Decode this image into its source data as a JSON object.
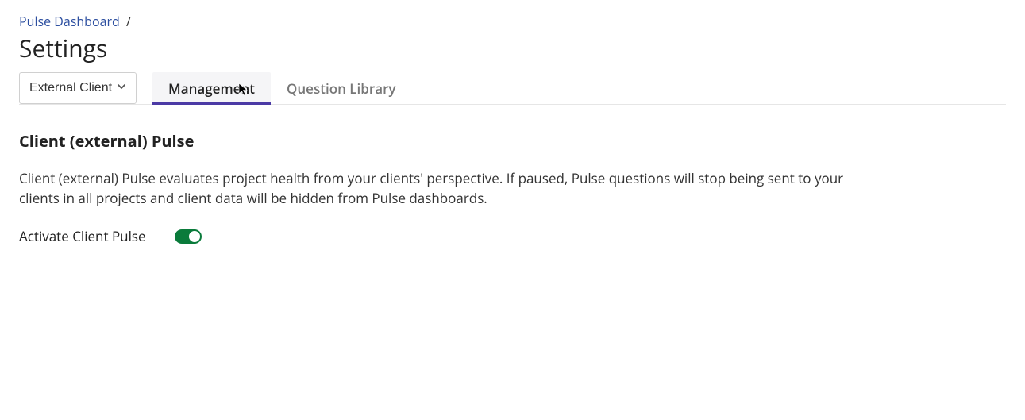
{
  "breadcrumb": {
    "parent": "Pulse Dashboard",
    "separator": "/"
  },
  "page_title": "Settings",
  "dropdown": {
    "selected": "External Client"
  },
  "tabs": {
    "management": {
      "label": "Management",
      "active": true
    },
    "question_library": {
      "label": "Question Library",
      "active": false
    }
  },
  "section": {
    "title": "Client (external) Pulse",
    "description": "Client (external) Pulse evaluates project health from your clients' perspective. If paused, Pulse questions will stop being sent to your clients in all projects and client data will be hidden from Pulse dashboards.",
    "toggle_label": "Activate Client Pulse",
    "toggle_on": true
  },
  "colors": {
    "link": "#2d4fa0",
    "tab_active_underline": "#4b3aa5",
    "toggle_on": "#0a7b3b"
  }
}
